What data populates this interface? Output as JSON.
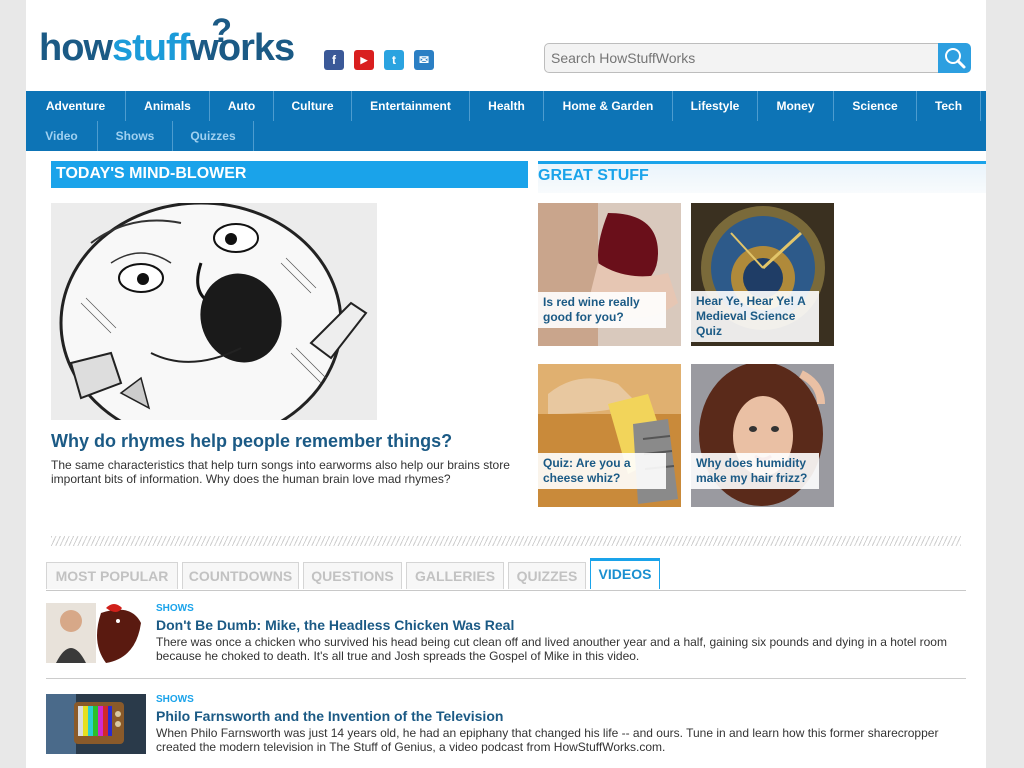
{
  "header": {
    "logo": {
      "part1": "how",
      "part2": "stuff",
      "part3": "works",
      "mark": "?"
    },
    "social": [
      {
        "icon": "facebook-icon",
        "glyph": "f",
        "color": "#3b5998"
      },
      {
        "icon": "youtube-icon",
        "glyph": "▶",
        "color": "#d91f1f"
      },
      {
        "icon": "twitter-icon",
        "glyph": "t",
        "color": "#2aa3e0"
      },
      {
        "icon": "email-icon",
        "glyph": "✉",
        "color": "#2b7fc4"
      }
    ],
    "search": {
      "placeholder": "Search HowStuffWorks"
    }
  },
  "nav": {
    "row1": [
      "Adventure",
      "Animals",
      "Auto",
      "Culture",
      "Entertainment",
      "Health",
      "Home & Garden",
      "Lifestyle",
      "Money",
      "Science",
      "Tech"
    ],
    "row2": [
      "Video",
      "Shows",
      "Quizzes"
    ]
  },
  "mindblower": {
    "heading": "TODAY'S MIND-BLOWER",
    "title": "Why do rhymes help people remember things?",
    "description": "The same characteristics that help turn songs into earworms also help our brains store important bits of information. Why does the human brain love mad rhymes?"
  },
  "greatstuff": {
    "heading": "GREAT STUFF",
    "tiles": [
      {
        "caption": "Is red wine really good for you?"
      },
      {
        "caption": "Hear Ye, Hear Ye! A Medieval Science Quiz"
      },
      {
        "caption": "Quiz: Are you a cheese whiz?"
      },
      {
        "caption": "Why does humidity make my hair frizz?"
      }
    ]
  },
  "tabs": [
    "MOST POPULAR",
    "COUNTDOWNS",
    "QUESTIONS",
    "GALLERIES",
    "QUIZZES",
    "VIDEOS"
  ],
  "videos": [
    {
      "category": "SHOWS",
      "title": "Don't Be Dumb: Mike, the Headless Chicken Was Real",
      "description": "There was once a chicken who survived his head being cut clean off and lived anouther year and a half, gaining six pounds and dying in a hotel room because he choked to death. It's all true and Josh spreads the Gospel of Mike in this video."
    },
    {
      "category": "SHOWS",
      "title": "Philo Farnsworth and the Invention of the Television",
      "description": "When Philo Farnsworth was just 14 years old, he had an epiphany that changed his life -- and ours. Tune in and learn how this former sharecropper created the modern television in The Stuff of Genius, a video podcast from HowStuffWorks.com."
    }
  ]
}
